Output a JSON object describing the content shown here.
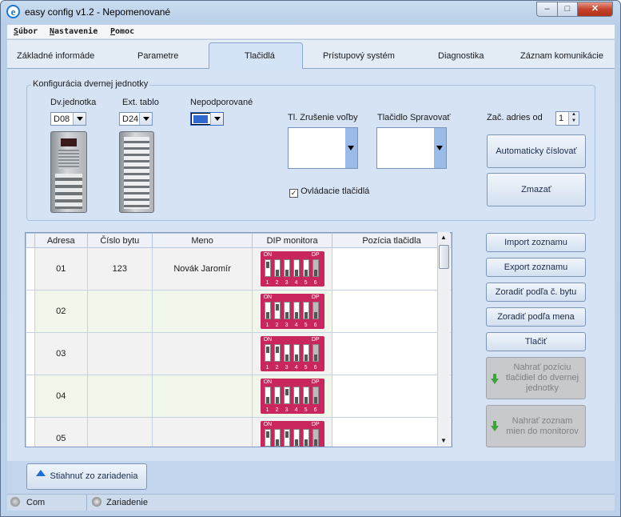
{
  "window": {
    "title": "easy config v1.2 - Nepomenované",
    "icon": "ie-e-icon"
  },
  "menu": [
    "Súbor",
    "Nastavenie",
    "Pomoc"
  ],
  "tabs": [
    "Základné informáde",
    "Parametre",
    "Tlačidlá",
    "Prístupový systém",
    "Diagnostika",
    "Záznam komunikácie"
  ],
  "active_tab": "Tlačidlá",
  "group": {
    "title": "Konfigurácia dvernej jednotky",
    "dvjednotka": {
      "label": "Dv.jednotka",
      "value": "D08"
    },
    "exttablo": {
      "label": "Ext. tablo",
      "value": "D24"
    },
    "nepodporovane": {
      "label": "Nepodporované",
      "value": ""
    },
    "zrusenie": {
      "label": "Tl. Zrušenie voľby"
    },
    "spravovat": {
      "label": "Tlačidlo Spravovať"
    },
    "zac_adries": {
      "label": "Zač. adries od",
      "value": "1"
    },
    "checkbox": {
      "label": "Ovládacie tlačidlá",
      "checked": true
    },
    "btn_auto": "Automaticky číslovať",
    "btn_delete": "Zmazať"
  },
  "table": {
    "columns": [
      "Adresa",
      "Číslo bytu",
      "Meno",
      "DIP monitora",
      "Pozícia tlačidla"
    ],
    "dip_on": "ON",
    "dip_dp": "DP",
    "dip_numbers": [
      "1",
      "2",
      "3",
      "4",
      "5",
      "6"
    ],
    "rows": [
      {
        "adresa": "01",
        "cislo": "123",
        "meno": "Novák Jaromír",
        "dip": [
          1,
          0,
          0,
          0,
          0,
          0
        ]
      },
      {
        "adresa": "02",
        "cislo": "",
        "meno": "",
        "dip": [
          0,
          1,
          0,
          0,
          0,
          0
        ]
      },
      {
        "adresa": "03",
        "cislo": "",
        "meno": "",
        "dip": [
          1,
          1,
          0,
          0,
          0,
          0
        ]
      },
      {
        "adresa": "04",
        "cislo": "",
        "meno": "",
        "dip": [
          0,
          0,
          1,
          0,
          0,
          0
        ]
      },
      {
        "adresa": "05",
        "cislo": "",
        "meno": "",
        "dip": [
          1,
          0,
          1,
          0,
          0,
          0
        ]
      }
    ]
  },
  "side_buttons": [
    "Import zoznamu",
    "Export zoznamu",
    "Zoradiť podľa č. bytu",
    "Zoradiť podľa mena",
    "Tlačiť"
  ],
  "disabled_buttons": [
    "Nahrať pozíciu tlačidiel do dvernej jednotky",
    "Nahrať zoznam mien do monitorov"
  ],
  "bottom_button": "Stiahnuť zo zariadenia",
  "status": {
    "com": "Com",
    "device": "Zariadenie"
  },
  "colors": {
    "dip_red": "#c8265c",
    "accent": "#9bbce8"
  }
}
